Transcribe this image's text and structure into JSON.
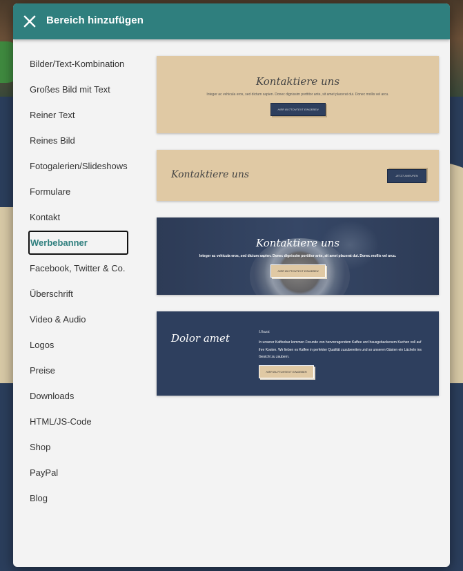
{
  "modal": {
    "title": "Bereich hinzufügen",
    "close_icon": "close-icon",
    "header_color": "#2f7f7e"
  },
  "sidebar": {
    "active_index": 7,
    "items": [
      {
        "label": "Bilder/Text-Kombination"
      },
      {
        "label": "Großes Bild mit Text"
      },
      {
        "label": "Reiner Text"
      },
      {
        "label": "Reines Bild"
      },
      {
        "label": "Fotogalerien/Slideshows"
      },
      {
        "label": "Formulare"
      },
      {
        "label": "Kontakt"
      },
      {
        "label": "Werbebanner"
      },
      {
        "label": "Facebook, Twitter & Co."
      },
      {
        "label": "Überschrift"
      },
      {
        "label": "Video & Audio"
      },
      {
        "label": "Logos"
      },
      {
        "label": "Preise"
      },
      {
        "label": "Downloads"
      },
      {
        "label": "HTML/JS-Code"
      },
      {
        "label": "Shop"
      },
      {
        "label": "PayPal"
      },
      {
        "label": "Blog"
      }
    ]
  },
  "templates": [
    {
      "title": "Kontaktiere uns",
      "text": "Integer ac vehicula eros, sed dictum sapien. Donec dignissim porttitor ante, sit amet placerat dui. Donec mollis vel arcu.",
      "button": "HIER BUTTONTEXT EINGEBEN"
    },
    {
      "title": "Kontaktiere uns",
      "button": "JETZT ANRUFEN"
    },
    {
      "title": "Kontaktiere uns",
      "text": "Integer ac vehicula eros, sed dictum sapien. Donec dignissim porttitor ante, sit amet placerat dui. Donec mollis vel arcu.",
      "button": "HIER BUTTONTEXT EINGEBEN"
    },
    {
      "title": "Dolor amet",
      "small_heading": "Ubunt",
      "text": "In unserer Kaffeebar kommen Freunde von hervorragendem Kaffee und hausgebackenem Kuchen voll auf ihre Kosten. Wir lieben es Kaffee in perfekter Qualität zuzubereiten und so unseren Gästen ein Lächeln ins Gesicht zu zaubern.",
      "button": "HIER BUTTONTEXT EINGEBEN"
    }
  ],
  "colors": {
    "beige": "#e0c9a4",
    "navy": "#2e3f5e",
    "teal": "#2f7f7e"
  }
}
